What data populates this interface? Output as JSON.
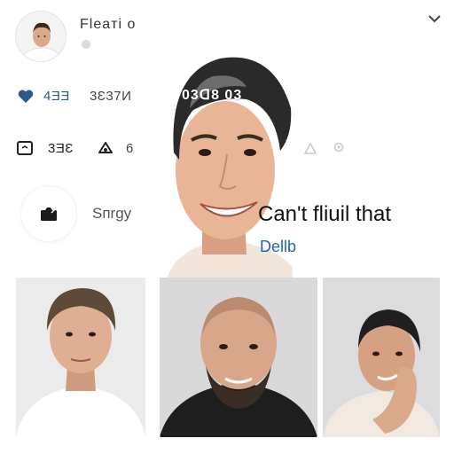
{
  "header": {
    "profile_name": "Fleaтi o",
    "menu_icon": "chevron-down-icon"
  },
  "stats": {
    "likes_count": "4ƎƎ",
    "views_count": "3Ɛ37И",
    "comments_count": "3ƎƐ",
    "shares_count": "6"
  },
  "action": {
    "label": "Sᴨrgy",
    "icon": "camera-icon"
  },
  "main_photo": {
    "overlay_text": "03ᗡ8 03"
  },
  "message": {
    "headline": "Can't fliuil that",
    "link_text": "Dellb"
  },
  "colors": {
    "accent": "#1f66b8",
    "heart": "#2a5a8a"
  }
}
